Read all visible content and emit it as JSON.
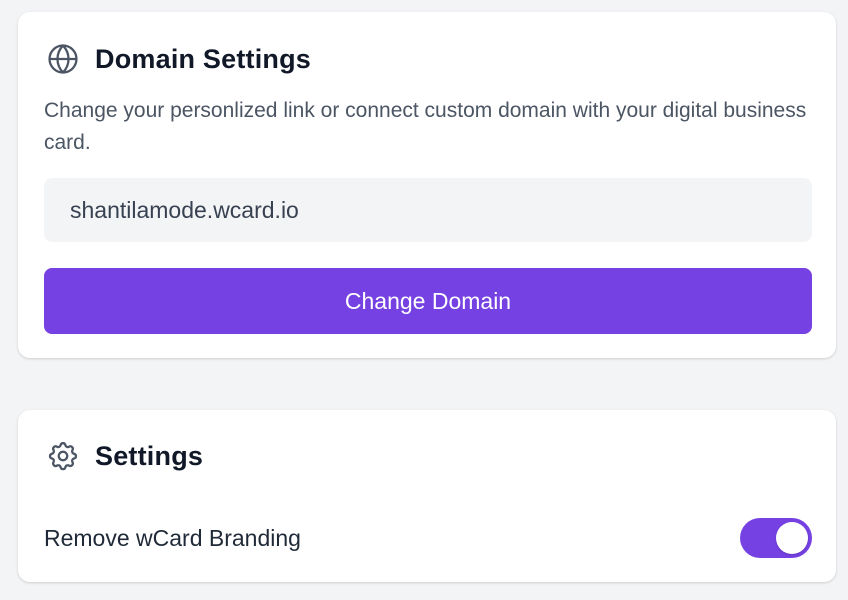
{
  "domain_settings": {
    "icon": "globe-icon",
    "title": "Domain Settings",
    "description": "Change your personlized link or connect custom domain with your digital business card.",
    "domain_value": "shantilamode.wcard.io",
    "change_button_label": "Change Domain"
  },
  "settings": {
    "icon": "gear-icon",
    "title": "Settings",
    "remove_branding_label": "Remove wCard Branding",
    "remove_branding_enabled": true
  },
  "colors": {
    "accent": "#7541e2",
    "page_background": "#f3f4f6",
    "card_background": "#ffffff",
    "field_background": "#f3f4f6"
  }
}
